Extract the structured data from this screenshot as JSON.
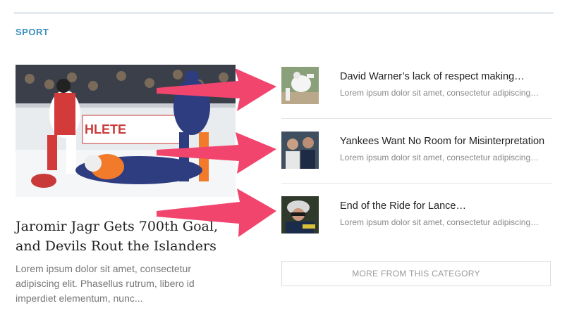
{
  "section": {
    "title": "SPORT"
  },
  "featured": {
    "title": "Jaromir Jagr Gets 700th Goal, and Devils Rout the Islanders",
    "excerpt": "Lorem ipsum dolor sit amet, consectetur adipiscing elit. Phasellus rutrum, libero id imperdiet elementum, nunc...",
    "image_sign_text": "HLETE"
  },
  "items": [
    {
      "title": "David Warner’s lack of respect making…",
      "excerpt": "Lorem ipsum dolor sit amet, consectetur adipiscing…"
    },
    {
      "title": "Yankees Want No Room for Misinterpretation",
      "excerpt": "Lorem ipsum dolor sit amet, consectetur adipiscing…"
    },
    {
      "title": "End of the Ride for Lance…",
      "excerpt": "Lorem ipsum dolor sit amet, consectetur adipiscing…"
    }
  ],
  "more_button": {
    "label": "MORE FROM THIS CATEGORY"
  },
  "colors": {
    "accent": "#3b8fbf",
    "arrow": "#f2456d"
  }
}
